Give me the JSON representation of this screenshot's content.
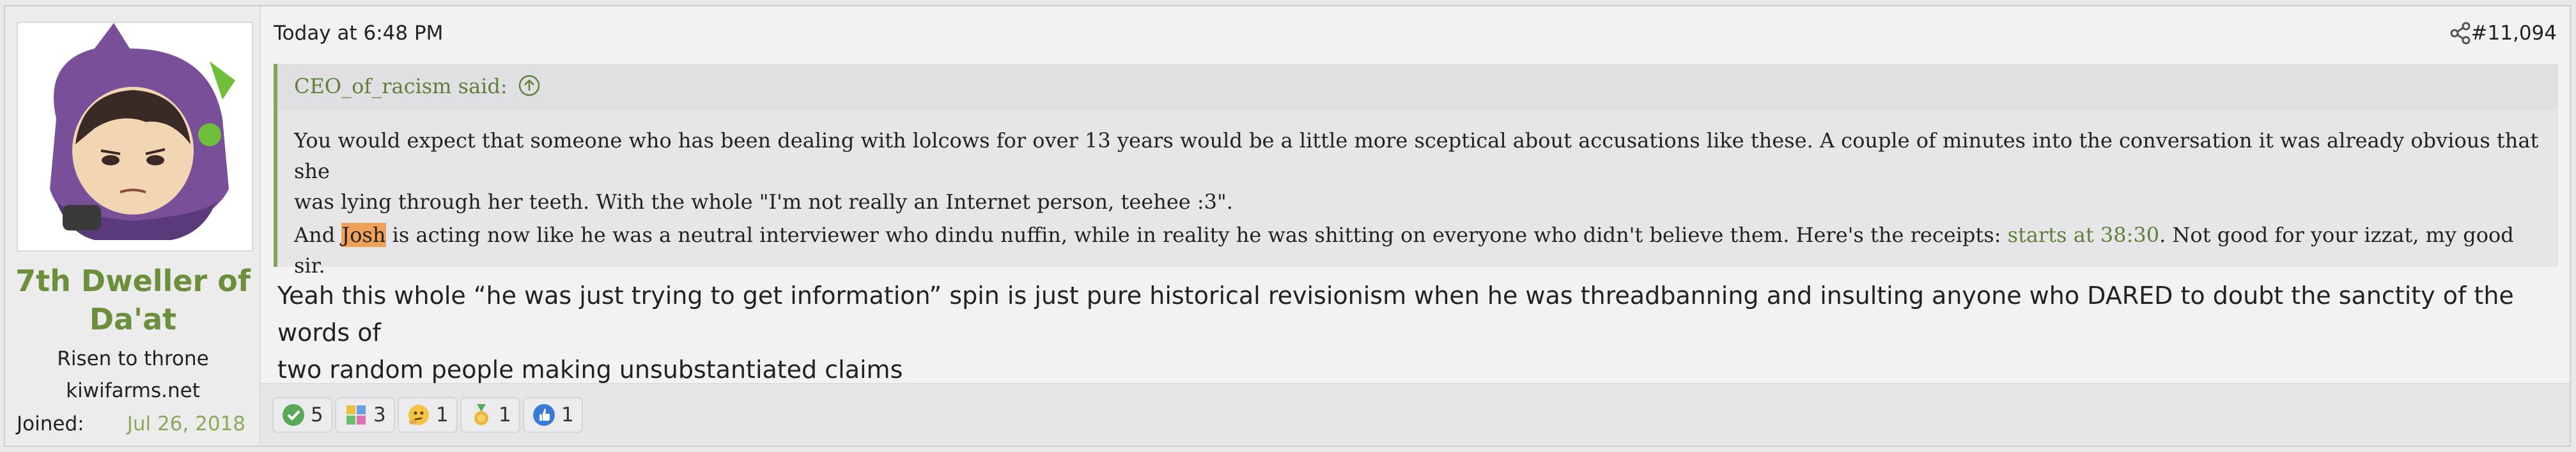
{
  "user": {
    "username_line1": "7th Dweller of",
    "username_line2": "Da'at",
    "title": "Risen to throne",
    "site": "kiwifarms.net",
    "joined_label": "Joined:",
    "joined_value": "Jul 26, 2018"
  },
  "post": {
    "timestamp": "Today at 6:48 PM",
    "number": "#11,094",
    "quote": {
      "author": "CEO_of_racism said:",
      "p1_line1": "You would expect that someone who has been dealing with lolcows for over 13 years would be a little more sceptical about accusations like these. A couple of minutes into the conversation it was already obvious that she",
      "p1_line2": "was lying through her teeth. With the whole \"I'm not really an Internet person, teehee :3\".",
      "p2_pre": "And ",
      "p2_highlight": "Josh",
      "p2_mid": " is acting now like he was a neutral interviewer who dindu nuffin, while in reality he was shitting on everyone who didn't believe them. Here's the receipts: ",
      "p2_link": "starts at 38:30",
      "p2_post": ". Not good for your izzat, my good sir."
    },
    "body_line1": "Yeah this whole “he was just trying to get information” spin is just pure historical revisionism when he was threadbanning and insulting anyone who DARED to doubt the sanctity of the words of",
    "body_line2": "two random people making unsubstantiated claims"
  },
  "reactions": [
    {
      "icon": "checkmark-icon",
      "count": "5"
    },
    {
      "icon": "puzzle-icon",
      "count": "3"
    },
    {
      "icon": "thinking-icon",
      "count": "1"
    },
    {
      "icon": "medal-icon",
      "count": "1"
    },
    {
      "icon": "thumbs-up-icon",
      "count": "1"
    }
  ],
  "colors": {
    "accent_green": "#6b8f3a",
    "quote_border": "#7fa85a",
    "highlight": "#f0a15a"
  }
}
